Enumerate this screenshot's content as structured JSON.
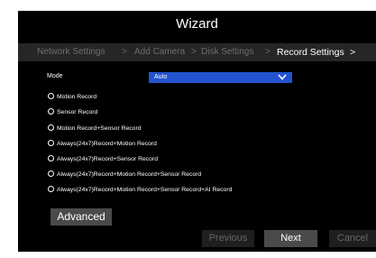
{
  "wizard": {
    "title": "Wizard",
    "steps": [
      {
        "label": "Network Settings"
      },
      {
        "label": ">"
      },
      {
        "label": "Add Camera"
      },
      {
        "label": ">"
      },
      {
        "label": "Disk Settings"
      },
      {
        "label": ">"
      },
      {
        "label": "Record Settings"
      },
      {
        "label": ">"
      }
    ],
    "current_step": "Record Settings"
  },
  "mode": {
    "label": "Mode",
    "value": "Auto"
  },
  "options": [
    {
      "label": "Motion Record"
    },
    {
      "label": "Sensor Record"
    },
    {
      "label": "Motion Record+Sensor Record"
    },
    {
      "label": "Always(24x7)Record+Motion Record"
    },
    {
      "label": "Always(24x7)Record+Sensor Record"
    },
    {
      "label": "Always(24x7)Record+Motion  Record+Sensor Record"
    },
    {
      "label": "Always(24x7)Record+Motion  Record+Sensor Record+AI  Record"
    }
  ],
  "buttons": {
    "advanced": "Advanced",
    "previous": "Previous",
    "next": "Next",
    "cancel": "Cancel"
  },
  "colors": {
    "background": "#000000",
    "step_bar": "#262626",
    "select": "#2354d0",
    "button_active": "#4a4a4a"
  }
}
